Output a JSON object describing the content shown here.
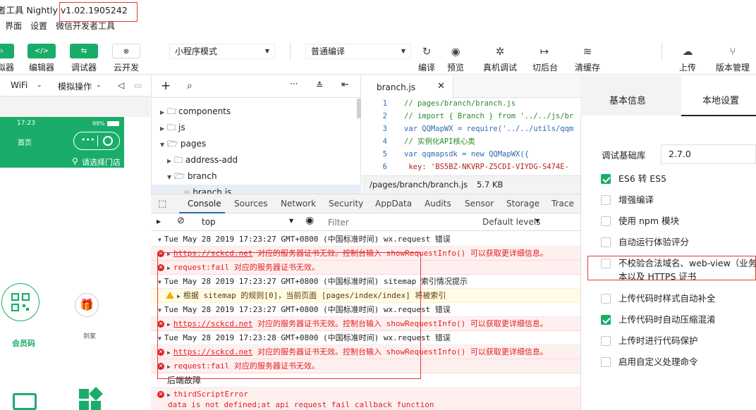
{
  "title_bar": {
    "text": "者工具 Nightly v1.02.1905242"
  },
  "menu": [
    "界面",
    "设置",
    "微信开发者工具"
  ],
  "toolbar": {
    "buttons": [
      {
        "label": "拟器",
        "icon": "simulator-icon"
      },
      {
        "label": "编辑器",
        "icon": "editor-icon",
        "glyph": "</>"
      },
      {
        "label": "调试器",
        "icon": "debugger-icon",
        "glyph": "⇆"
      },
      {
        "label": "云开发",
        "icon": "cloud-dev-icon",
        "glyph": "⊗"
      }
    ],
    "mode_select": "小程序模式",
    "compile_select": "普通编译",
    "actions": [
      {
        "label": "编译",
        "icon": "refresh-icon",
        "glyph": "↻"
      },
      {
        "label": "预览",
        "icon": "eye-icon",
        "glyph": "◉"
      },
      {
        "label": "真机调试",
        "icon": "bug-icon",
        "glyph": "✲"
      },
      {
        "label": "切后台",
        "icon": "switch-background-icon",
        "glyph": "↦"
      },
      {
        "label": "清缓存",
        "icon": "layers-icon",
        "glyph": "≋"
      },
      {
        "label": "上传",
        "icon": "upload-icon",
        "glyph": "☁"
      },
      {
        "label": "版本管理",
        "icon": "version-icon",
        "glyph": "⑂"
      }
    ]
  },
  "simulator": {
    "network": "WiFi",
    "operation": "模拟操作",
    "status_time": "17:23",
    "battery": "99%",
    "page_title": "首页",
    "capsule_dots": "•••",
    "store_link": "请选择门店",
    "member_code": "会员码",
    "to_home": "到家"
  },
  "file_tree": {
    "items": [
      {
        "label": "components",
        "depth": 0,
        "open": false
      },
      {
        "label": "js",
        "depth": 0,
        "open": false
      },
      {
        "label": "pages",
        "depth": 0,
        "open": true
      },
      {
        "label": "address-add",
        "depth": 1,
        "open": false
      },
      {
        "label": "branch",
        "depth": 1,
        "open": true
      },
      {
        "label": "branch.js",
        "depth": 2,
        "open": false
      }
    ]
  },
  "editor": {
    "tab": "branch.js",
    "lines": [
      {
        "n": "1",
        "text": "// pages/branch/branch.js"
      },
      {
        "n": "2",
        "text": "// import { Branch } from '../../js/br"
      },
      {
        "n": "3",
        "text": "var QQMapWX = require('../../utils/qqm"
      },
      {
        "n": "4",
        "text": "// 实例化API核心类"
      },
      {
        "n": "5",
        "text": "var qqmapsdk = new QQMapWX({"
      },
      {
        "n": "6",
        "text": "  key: 'BS5BZ-NKVRP-Z5CDI-VIYDG-S474E-"
      }
    ],
    "status_path": "/pages/branch/branch.js",
    "status_size": "5.7 KB"
  },
  "devtools": {
    "tabs": [
      "Console",
      "Sources",
      "Network",
      "Security",
      "AppData",
      "Audits",
      "Sensor",
      "Storage",
      "Trace"
    ],
    "context": "top",
    "filter_placeholder": "Filter",
    "levels": "Default levels"
  },
  "console": [
    {
      "type": "info",
      "text": "Tue May 28 2019 17:23:27 GMT+0800 (中国标准时间) wx.request 错误"
    },
    {
      "type": "err-link",
      "link": "https://sckcd.net",
      "text": " 对应的服务器证书无效。控制台输入 showRequestInfo() 可以获取更详细信息。"
    },
    {
      "type": "err",
      "text": "request:fail 对应的服务器证书无效。"
    },
    {
      "type": "info",
      "text": "Tue May 28 2019 17:23:27 GMT+0800 (中国标准时间) sitemap 索引情况提示"
    },
    {
      "type": "warn",
      "text": "根据 sitemap 的规则[0]，当前页面 [pages/index/index] 将被索引"
    },
    {
      "type": "info",
      "text": "Tue May 28 2019 17:23:27 GMT+0800 (中国标准时间) wx.request 错误"
    },
    {
      "type": "err-link",
      "link": "https://sckcd.net",
      "text": " 对应的服务器证书无效。控制台输入 showRequestInfo() 可以获取更详细信息。"
    },
    {
      "type": "info",
      "text": "Tue May 28 2019 17:23:28 GMT+0800 (中国标准时间) wx.request 错误"
    },
    {
      "type": "err-link",
      "link": "https://sckcd.net",
      "text": " 对应的服务器证书无效。控制台输入 showRequestInfo() 可以获取更详细信息。"
    },
    {
      "type": "err",
      "text": "request:fail 对应的服务器证书无效。"
    },
    {
      "type": "plain",
      "text": "后端故障"
    },
    {
      "type": "err",
      "text": "thirdScriptError"
    },
    {
      "type": "err-plain",
      "text": "data is not defined;at api request fail callback function"
    }
  ],
  "right_panel": {
    "tabs": [
      "基本信息",
      "本地设置"
    ],
    "lib_label": "调试基础库",
    "lib_version": "2.7.0",
    "options": [
      {
        "label": "ES6 转 ES5",
        "checked": true
      },
      {
        "label": "增强编译",
        "checked": false
      },
      {
        "label": "使用 npm 模块",
        "checked": false
      },
      {
        "label": "自动运行体验评分",
        "checked": false
      },
      {
        "label": "不校验合法域名、web-view（业务",
        "label2": "本以及 HTTPS 证书",
        "checked": false
      },
      {
        "label": "上传代码时样式自动补全",
        "checked": false
      },
      {
        "label": "上传代码时自动压缩混淆",
        "checked": true
      },
      {
        "label": "上传时进行代码保护",
        "checked": false
      },
      {
        "label": "启用自定义处理命令",
        "checked": false
      }
    ]
  },
  "colors": {
    "accent": "#1aad6a",
    "error": "#e02020",
    "highlight_box": "#e23a3a"
  }
}
